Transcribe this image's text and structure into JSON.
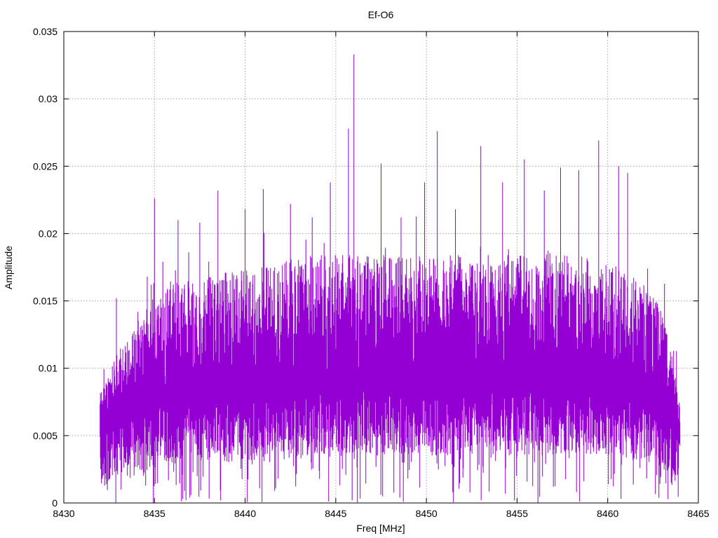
{
  "chart_data": {
    "type": "line",
    "title": "Ef-O6",
    "xlabel": "Freq [MHz]",
    "ylabel": "Amplitude",
    "xlim": [
      8430,
      8465
    ],
    "ylim": [
      0,
      0.035
    ],
    "xticks": [
      8430,
      8435,
      8440,
      8445,
      8450,
      8455,
      8460,
      8465
    ],
    "yticks": [
      0,
      0.005,
      0.01,
      0.015,
      0.02,
      0.025,
      0.03,
      0.035
    ],
    "xtick_labels": [
      "8430",
      "8435",
      "8440",
      "8445",
      "8450",
      "8455",
      "8460",
      "8465"
    ],
    "ytick_labels": [
      "0",
      "0.005",
      "0.01",
      "0.015",
      "0.02",
      "0.025",
      "0.03",
      "0.035"
    ],
    "grid": true,
    "series_color": "#9400d3",
    "data_range_x": [
      8432.0,
      8464.0
    ],
    "envelope": {
      "x": [
        8432.0,
        8433.0,
        8434.0,
        8435.0,
        8436.0,
        8438.0,
        8440.0,
        8442.0,
        8444.0,
        8446.0,
        8448.0,
        8450.0,
        8452.0,
        8454.0,
        8456.0,
        8458.0,
        8460.0,
        8462.0,
        8463.0,
        8463.5,
        8464.0
      ],
      "upper": [
        0.008,
        0.011,
        0.013,
        0.015,
        0.016,
        0.0165,
        0.017,
        0.0175,
        0.018,
        0.018,
        0.018,
        0.018,
        0.018,
        0.018,
        0.018,
        0.018,
        0.0175,
        0.016,
        0.014,
        0.011,
        0.007
      ],
      "mid": [
        0.006,
        0.0065,
        0.007,
        0.0075,
        0.008,
        0.008,
        0.0085,
        0.0085,
        0.009,
        0.009,
        0.009,
        0.009,
        0.009,
        0.009,
        0.009,
        0.0085,
        0.0085,
        0.008,
        0.0075,
        0.007,
        0.0055
      ],
      "lower": [
        0.001,
        0.0015,
        0.002,
        0.0025,
        0.003,
        0.003,
        0.003,
        0.003,
        0.0035,
        0.0035,
        0.0035,
        0.0035,
        0.0035,
        0.0035,
        0.0035,
        0.0035,
        0.0035,
        0.003,
        0.0025,
        0.002,
        0.001
      ]
    },
    "peaks": [
      {
        "x": 8432.9,
        "y": 0.0152
      },
      {
        "x": 8434.6,
        "y": 0.0168
      },
      {
        "x": 8435.0,
        "y": 0.0226
      },
      {
        "x": 8436.3,
        "y": 0.021
      },
      {
        "x": 8437.5,
        "y": 0.0208
      },
      {
        "x": 8438.5,
        "y": 0.0232
      },
      {
        "x": 8440.0,
        "y": 0.0218
      },
      {
        "x": 8441.0,
        "y": 0.0233
      },
      {
        "x": 8442.5,
        "y": 0.0222
      },
      {
        "x": 8443.7,
        "y": 0.0212
      },
      {
        "x": 8444.7,
        "y": 0.0238
      },
      {
        "x": 8445.7,
        "y": 0.0278
      },
      {
        "x": 8446.0,
        "y": 0.0333
      },
      {
        "x": 8447.5,
        "y": 0.0252
      },
      {
        "x": 8448.6,
        "y": 0.0212
      },
      {
        "x": 8449.9,
        "y": 0.0238
      },
      {
        "x": 8450.6,
        "y": 0.0276
      },
      {
        "x": 8451.6,
        "y": 0.0218
      },
      {
        "x": 8453.0,
        "y": 0.0265
      },
      {
        "x": 8454.2,
        "y": 0.0238
      },
      {
        "x": 8455.4,
        "y": 0.0255
      },
      {
        "x": 8456.5,
        "y": 0.0232
      },
      {
        "x": 8457.4,
        "y": 0.0249
      },
      {
        "x": 8458.4,
        "y": 0.0247
      },
      {
        "x": 8459.5,
        "y": 0.0269
      },
      {
        "x": 8460.6,
        "y": 0.025
      },
      {
        "x": 8461.1,
        "y": 0.0245
      },
      {
        "x": 8462.2,
        "y": 0.0174
      }
    ]
  }
}
